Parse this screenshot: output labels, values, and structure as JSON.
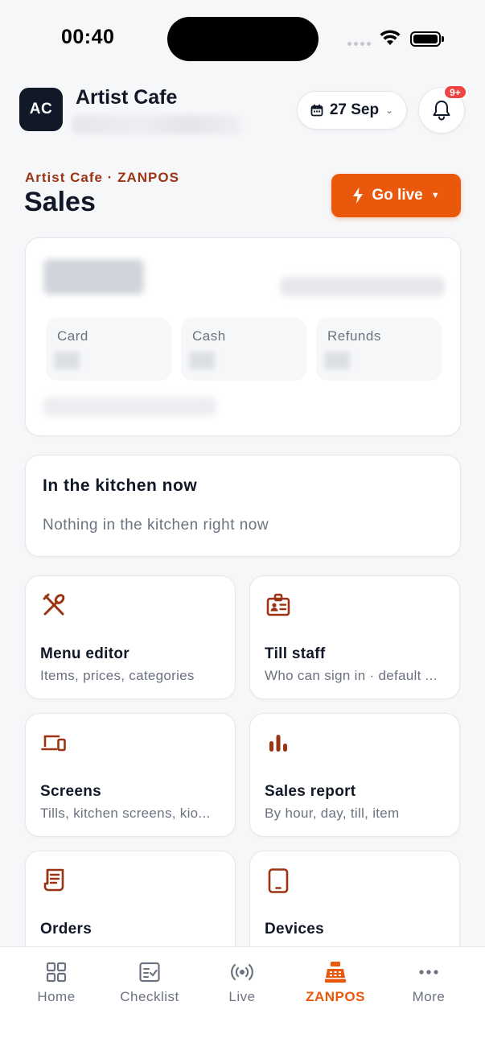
{
  "status_bar": {
    "time": "00:40"
  },
  "header": {
    "avatar_initials": "AC",
    "venue_name": "Artist Cafe",
    "date_label": "27 Sep",
    "notification_badge": "9+"
  },
  "title_area": {
    "breadcrumb": "Artist Cafe · ZANPOS",
    "title": "Sales",
    "go_live_label": "Go live"
  },
  "sales_summary": {
    "stats": [
      {
        "label": "Card"
      },
      {
        "label": "Cash"
      },
      {
        "label": "Refunds"
      }
    ]
  },
  "kitchen": {
    "title": "In the kitchen now",
    "empty_message": "Nothing in the kitchen right now"
  },
  "tiles": [
    {
      "title": "Menu editor",
      "subtitle": "Items, prices, categories",
      "icon": "utensils-icon"
    },
    {
      "title": "Till staff",
      "subtitle": "Who can sign in · default ...",
      "icon": "id-badge-icon"
    },
    {
      "title": "Screens",
      "subtitle": "Tills, kitchen screens, kio...",
      "icon": "devices-icon"
    },
    {
      "title": "Sales report",
      "subtitle": "By hour, day, till, item",
      "icon": "bar-chart-icon"
    },
    {
      "title": "Orders",
      "subtitle": "",
      "icon": "receipt-icon"
    },
    {
      "title": "Devices",
      "subtitle": "",
      "icon": "tablet-icon"
    }
  ],
  "tab_bar": {
    "tabs": [
      {
        "label": "Home",
        "icon": "grid-icon"
      },
      {
        "label": "Checklist",
        "icon": "checklist-icon"
      },
      {
        "label": "Live",
        "icon": "broadcast-icon"
      },
      {
        "label": "ZANPOS",
        "icon": "cash-register-icon",
        "active": true
      },
      {
        "label": "More",
        "icon": "more-dots-icon"
      }
    ]
  },
  "colors": {
    "accent": "#ea580c",
    "accent_dark": "#9a3412",
    "badge": "#ef4444",
    "text": "#111827",
    "muted": "#6b7280"
  }
}
